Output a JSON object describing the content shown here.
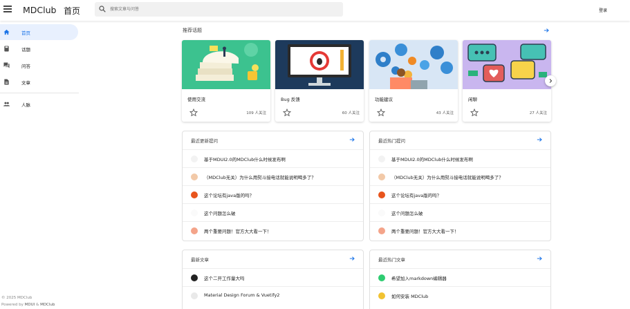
{
  "appbar": {
    "title": "MDClub",
    "subtitle": "首页",
    "search_placeholder": "搜索文章与问答",
    "login": "登录"
  },
  "sidebar": {
    "items": [
      {
        "label": "首页",
        "icon": "home-icon"
      },
      {
        "label": "话题",
        "icon": "book-icon"
      },
      {
        "label": "问答",
        "icon": "forum-icon"
      },
      {
        "label": "文章",
        "icon": "description-icon"
      },
      {
        "label": "人脉",
        "icon": "people-icon"
      }
    ],
    "copyright": "© 2025 MDClub",
    "powered_prefix": "Powered by ",
    "powered_link1": "MDUI",
    "powered_amp": " & ",
    "powered_link2": "MDClub"
  },
  "topics": {
    "title": "推荐话题",
    "cards": [
      {
        "name": "使用交流",
        "followers": "109 人关注"
      },
      {
        "name": "Bug 反馈",
        "followers": "60 人关注"
      },
      {
        "name": "功能建议",
        "followers": "43 人关注"
      },
      {
        "name": "闲聊",
        "followers": "27 人关注"
      }
    ]
  },
  "recent_questions": {
    "title": "最近更新提问",
    "items": [
      "基于MDUI2.0的MDClub什么时候发布啊",
      "（MDClub无关）为什么用熨斗接电话就能说明喝多了？",
      "这个论坛有java版的吗？",
      "这个问题怎么破",
      "两个重要问题！官方大大看一下！"
    ]
  },
  "hot_questions": {
    "title": "最近热门提问",
    "items": [
      "基于MDUI2.0的MDClub什么时候发布啊",
      "（MDClub无关）为什么用熨斗接电话就能说明喝多了？",
      "这个论坛有java版的吗？",
      "这个问题怎么破",
      "两个重要问题！官方大大看一下！"
    ]
  },
  "latest_articles": {
    "title": "最新文章",
    "items": [
      "这个二开工作量大吗",
      "Material Design Forum & Vuetify2"
    ]
  },
  "hot_articles": {
    "title": "最近热门文章",
    "items": [
      "希望加入markdown编辑器",
      "如何安装 MDClub"
    ]
  },
  "colors": {
    "accent": "#1a73e8",
    "active_bg": "#e8f0fe"
  }
}
